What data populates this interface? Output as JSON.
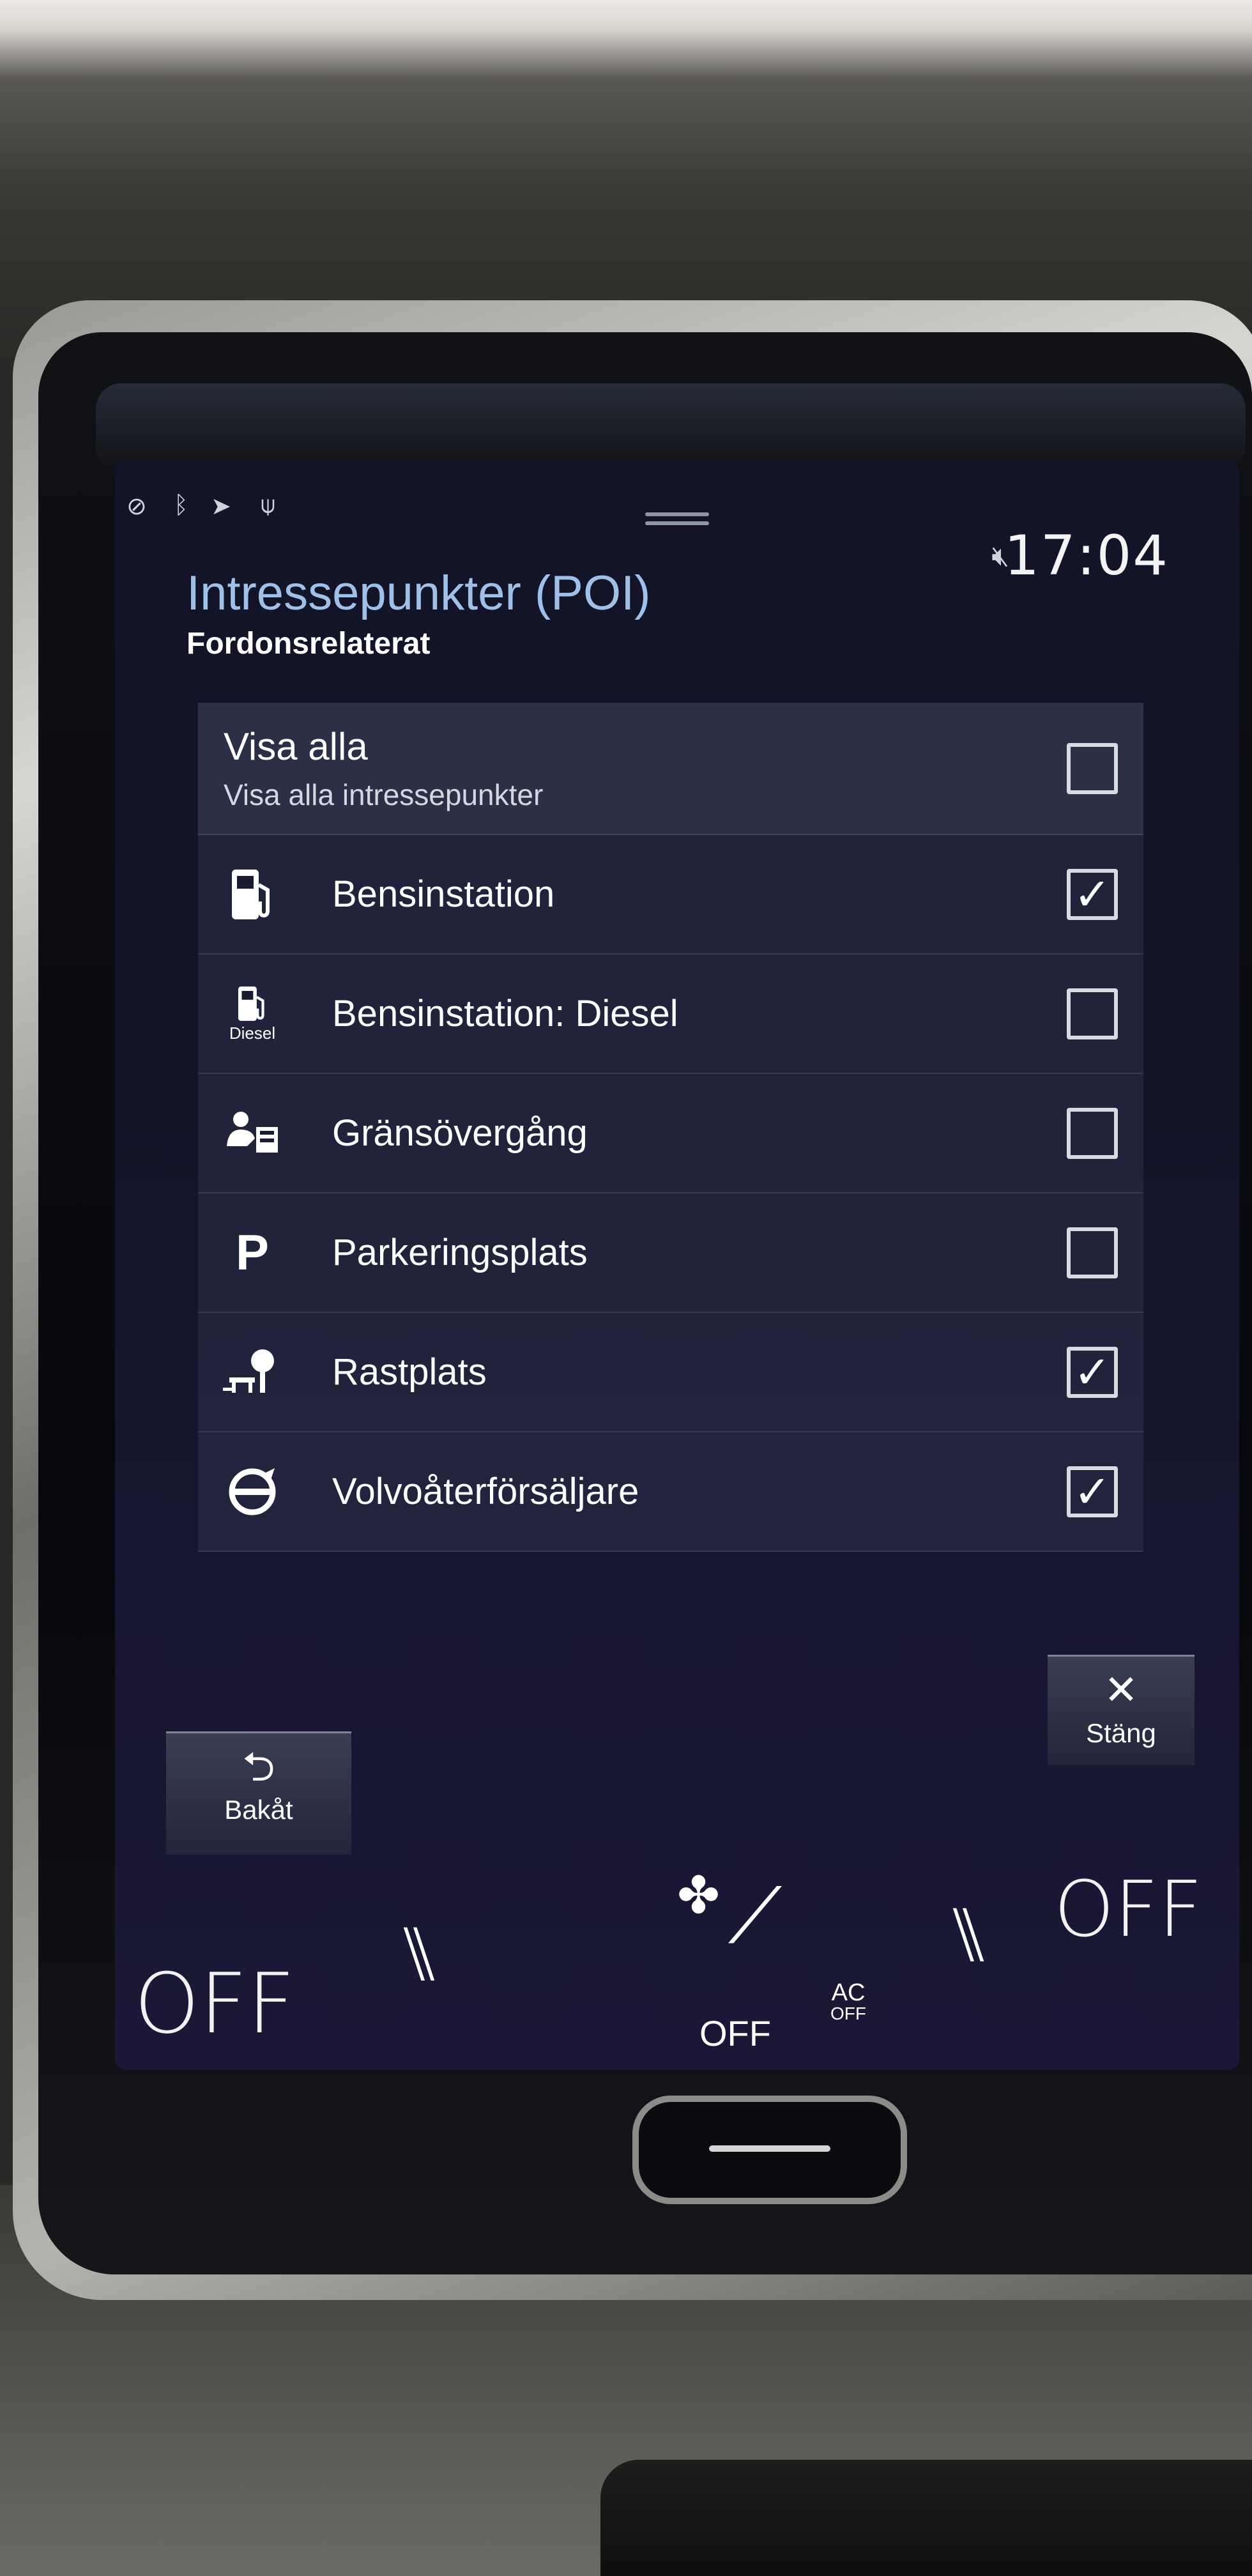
{
  "status_bar": {
    "icons": [
      "signal-off-icon",
      "bluetooth-icon",
      "navigation-arrow-icon",
      "antenna-icon"
    ],
    "mute_icon": "speaker-muted-icon",
    "time": "17:04"
  },
  "header": {
    "title": "Intressepunkter (POI)",
    "subtitle": "Fordonsrelaterat"
  },
  "list": {
    "show_all": {
      "label": "Visa alla",
      "description": "Visa alla intressepunkter",
      "checked": false
    },
    "items": [
      {
        "label": "Bensinstation",
        "icon": "fuel-pump-icon",
        "checked": true
      },
      {
        "label": "Bensinstation: Diesel",
        "icon": "diesel-pump-icon",
        "icon_caption": "Diesel",
        "checked": false
      },
      {
        "label": "Gränsövergång",
        "icon": "border-crossing-icon",
        "checked": false
      },
      {
        "label": "Parkeringsplats",
        "icon": "parking-icon",
        "icon_glyph": "P",
        "checked": false
      },
      {
        "label": "Rastplats",
        "icon": "rest-area-icon",
        "checked": true
      },
      {
        "label": "Volvoåterförsäljare",
        "icon": "volvo-dealer-icon",
        "checked": true
      }
    ]
  },
  "buttons": {
    "close": {
      "label": "Stäng",
      "icon": "close-x-icon"
    },
    "back": {
      "label": "Bakåt",
      "icon": "back-arrow-icon"
    }
  },
  "climate": {
    "left_temp": "OFF",
    "right_temp": "OFF",
    "fan_label": "OFF",
    "ac_label_top": "AC",
    "ac_label_bottom": "OFF"
  },
  "colors": {
    "screen_bg": "#141428",
    "title": "#9fc0e8",
    "text": "#ffffff"
  }
}
